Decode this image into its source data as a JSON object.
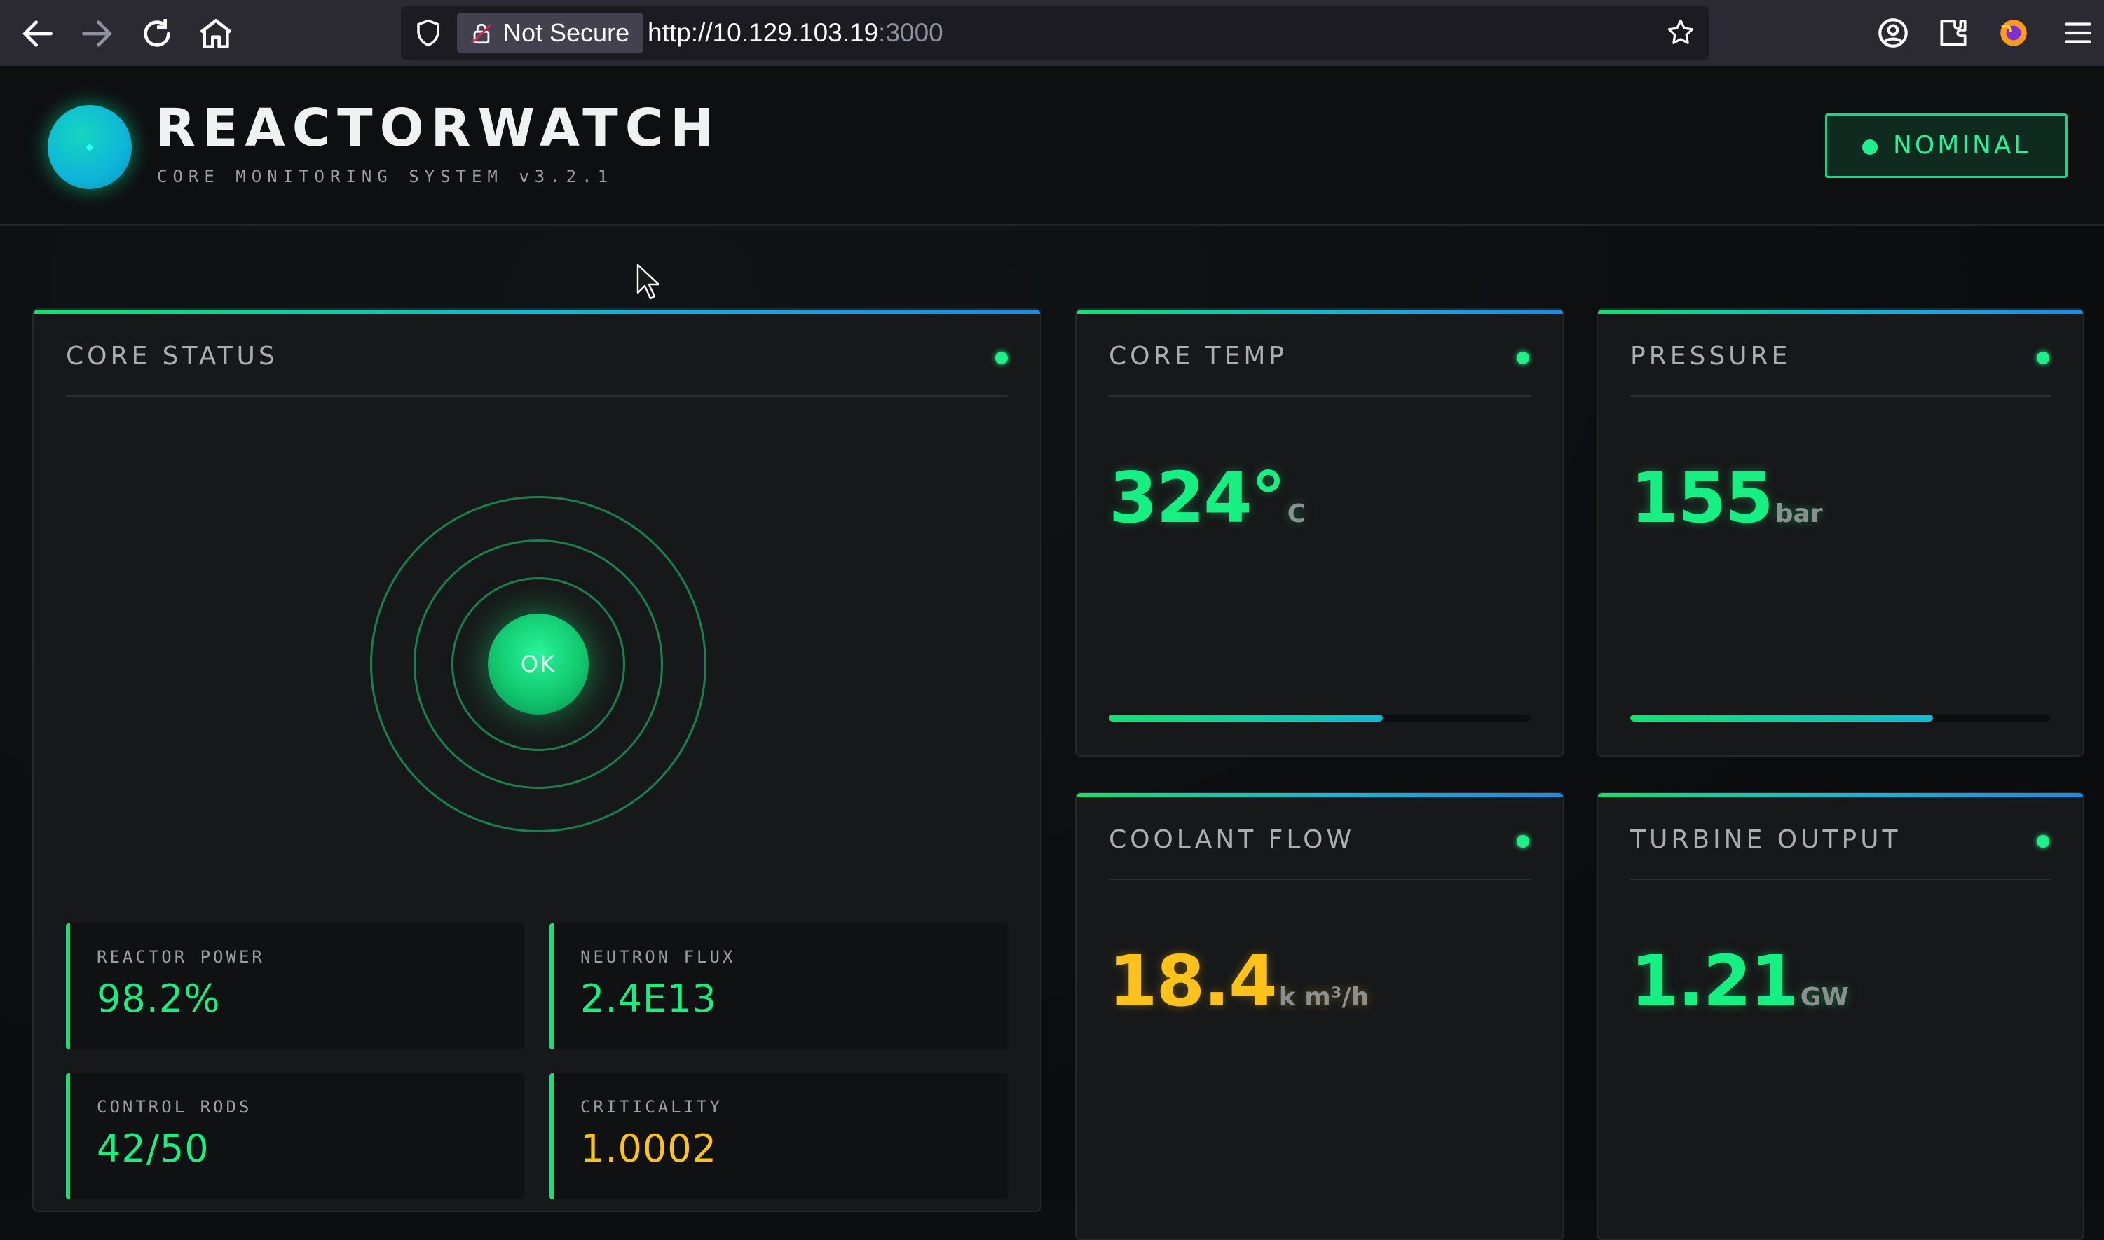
{
  "browser": {
    "security_label": "Not Secure",
    "url_host": "http://10.129.103.19",
    "url_port": ":3000"
  },
  "header": {
    "title": "REACTORWATCH",
    "subtitle": "CORE MONITORING SYSTEM v3.2.1",
    "status": "NOMINAL"
  },
  "core_status": {
    "title": "CORE STATUS",
    "core_label": "OK",
    "metrics": [
      {
        "label": "REACTOR POWER",
        "value": "98.2%",
        "tone": "green"
      },
      {
        "label": "NEUTRON FLUX",
        "value": "2.4E13",
        "tone": "green"
      },
      {
        "label": "CONTROL RODS",
        "value": "42/50",
        "tone": "green"
      },
      {
        "label": "CRITICALITY",
        "value": "1.0002",
        "tone": "amber"
      }
    ]
  },
  "cards": {
    "core_temp": {
      "title": "CORE TEMP",
      "value": "324°",
      "unit": "C",
      "level": 0.65
    },
    "pressure": {
      "title": "PRESSURE",
      "value": "155",
      "unit": "bar",
      "level": 0.72
    },
    "coolant_flow": {
      "title": "COOLANT FLOW",
      "value": "18.4",
      "unit": "k m³/h"
    },
    "turbine_output": {
      "title": "TURBINE OUTPUT",
      "value": "1.21",
      "unit": "GW"
    }
  },
  "colors": {
    "accent_green": "#16ef82",
    "accent_amber": "#ffc21a",
    "accent_blue": "#14b8d4"
  },
  "icons": [
    "back-arrow-icon",
    "forward-arrow-icon",
    "reload-icon",
    "home-icon",
    "shield-icon",
    "lock-icon",
    "star-icon",
    "account-icon",
    "extensions-icon",
    "firefox-icon",
    "menu-icon"
  ]
}
